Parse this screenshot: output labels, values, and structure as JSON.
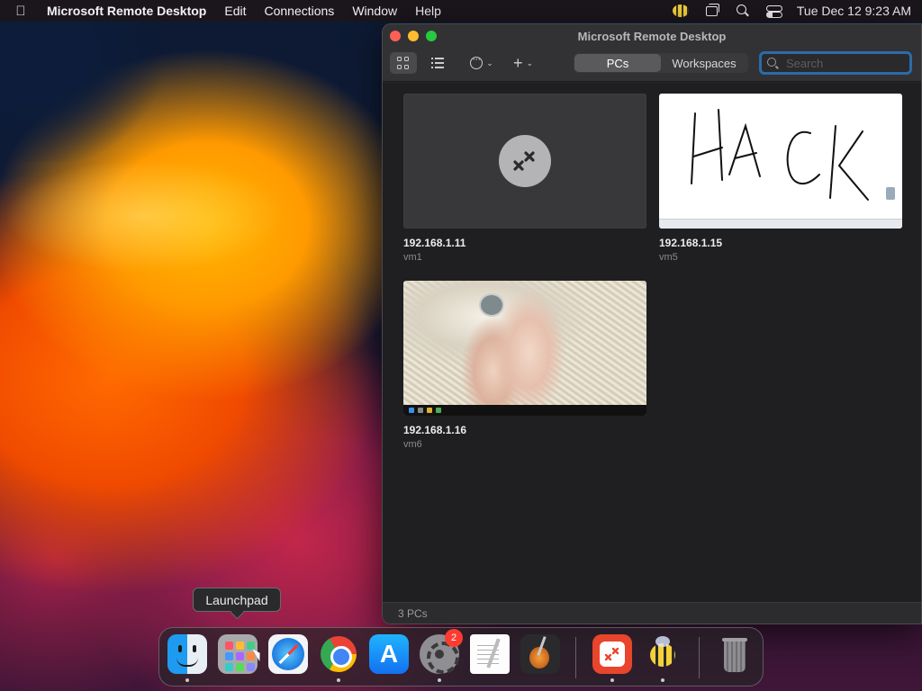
{
  "menubar": {
    "apple_icon": "apple-logo-icon",
    "app_name": "Microsoft Remote Desktop",
    "menus": [
      "Edit",
      "Connections",
      "Window",
      "Help"
    ],
    "clock": "Tue Dec 12  9:23 AM",
    "status_icons": [
      "bee-icon",
      "screens-icon",
      "search-icon",
      "control-center-icon"
    ]
  },
  "window": {
    "title": "Microsoft Remote Desktop",
    "toolbar": {
      "view_grid_icon": "grid-view-icon",
      "view_list_icon": "list-view-icon",
      "more_icon": "ellipsis-circle-icon",
      "add_icon": "plus-icon"
    },
    "tabs": [
      {
        "label": "PCs",
        "active": true
      },
      {
        "label": "Workspaces",
        "active": false
      }
    ],
    "search": {
      "placeholder": "Search",
      "value": ""
    },
    "pcs": [
      {
        "title": "192.168.1.11",
        "subtitle": "vm1",
        "thumbnail": "remote-desktop-logo"
      },
      {
        "title": "192.168.1.15",
        "subtitle": "vm5",
        "thumbnail": "hack-screenshot"
      },
      {
        "title": "192.168.1.16",
        "subtitle": "vm6",
        "thumbnail": "photo-screenshot"
      }
    ],
    "hack_text": "HACK",
    "status": "3 PCs"
  },
  "tooltip": {
    "text": "Launchpad"
  },
  "dock": {
    "items": [
      {
        "name": "Finder",
        "icon": "finder-icon",
        "running": true
      },
      {
        "name": "Launchpad",
        "icon": "launchpad-icon",
        "running": false
      },
      {
        "name": "Safari",
        "icon": "safari-icon",
        "running": false
      },
      {
        "name": "Google Chrome",
        "icon": "chrome-icon",
        "running": true
      },
      {
        "name": "App Store",
        "icon": "app-store-icon",
        "running": false
      },
      {
        "name": "System Settings",
        "icon": "settings-icon",
        "running": true,
        "badge": "2"
      },
      {
        "name": "TextEdit",
        "icon": "textedit-icon",
        "running": false
      },
      {
        "name": "GarageBand",
        "icon": "garageband-icon",
        "running": false
      },
      {
        "name": "Microsoft Remote Desktop",
        "icon": "remote-desktop-icon",
        "running": true
      },
      {
        "name": "Bee",
        "icon": "bee-icon",
        "running": true
      },
      {
        "name": "Trash",
        "icon": "trash-icon",
        "running": false
      }
    ]
  },
  "colors": {
    "accent": "#2c6ba8",
    "close": "#ff5f57",
    "minimize": "#febc2e",
    "maximize": "#28c840",
    "badge": "#ff3b30"
  }
}
